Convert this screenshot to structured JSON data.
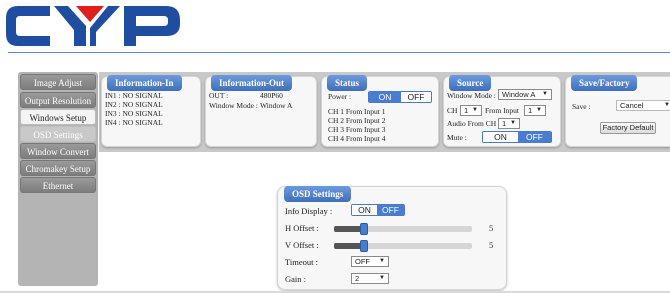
{
  "brand": {
    "logo_text": "CYP",
    "colors": {
      "logo_blue": "#1f4ea0",
      "logo_red": "#e01e1e",
      "accent": "#4a7dd0"
    }
  },
  "sidebar": {
    "items": [
      {
        "label": "Image Adjust"
      },
      {
        "label": "Output Resolution"
      },
      {
        "label": "Windows Setup"
      },
      {
        "label": "OSD Settings"
      },
      {
        "label": "Window Convert"
      },
      {
        "label": "Chromakey Setup"
      },
      {
        "label": "Ethernet"
      }
    ]
  },
  "info_in": {
    "title": "Information-In",
    "lines": [
      "IN1 : NO SIGNAL",
      "IN2 : NO SIGNAL",
      "IN3 : NO SIGNAL",
      "IN4 : NO SIGNAL"
    ]
  },
  "info_out": {
    "title": "Information-Out",
    "out_label": "OUT :",
    "out_value": "480P60",
    "mode_label": "Window Mode :",
    "mode_value": "Window A"
  },
  "status": {
    "title": "Status",
    "power_label": "Power :",
    "on": "ON",
    "off": "OFF",
    "power_state": "on",
    "channels": [
      "CH 1 From Input  1",
      "CH 2 From Input  2",
      "CH 3 From Input  3",
      "CH 4 From Input  4"
    ]
  },
  "source": {
    "title": "Source",
    "window_mode_label": "Window Mode :",
    "window_mode_value": "Window A",
    "ch_label": "CH",
    "ch_value": "1",
    "from_input_label": "From Input",
    "from_input_value": "1",
    "audio_label": "Audio From CH",
    "audio_value": "1",
    "mute_label": "Mute :",
    "on": "ON",
    "off": "OFF",
    "mute_state": "off"
  },
  "save_factory": {
    "title": "Save/Factory",
    "save_label": "Save :",
    "save_value": "Cancel",
    "factory_button": "Factory Default"
  },
  "osd": {
    "title": "OSD Settings",
    "info_display_label": "Info Display :",
    "on": "ON",
    "off": "OFF",
    "info_display_state": "off",
    "h_offset_label": "H Offset :",
    "h_offset_value": "5",
    "v_offset_label": "V Offset :",
    "v_offset_value": "5",
    "slider_fraction": 0.22,
    "timeout_label": "Timeout :",
    "timeout_value": "OFF",
    "gain_label": "Gain :",
    "gain_value": "2"
  }
}
